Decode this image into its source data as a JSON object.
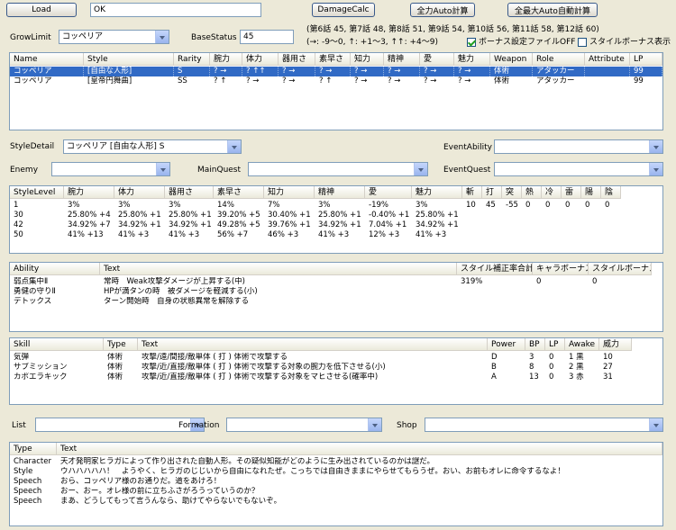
{
  "toolbar": {
    "load_label": "Load",
    "status_value": "OK",
    "damagecalc_label": "DamageCalc",
    "full_auto_label": "全力Auto計算",
    "max_auto_label": "全最大Auto自動計算"
  },
  "growlimit": {
    "label": "GrowLimit",
    "value": "コッペリア"
  },
  "basestatus": {
    "label": "BaseStatus",
    "value": "45"
  },
  "episodes_text": "(第6話 45, 第7話 48, 第8話 51, 第9話 54, 第10話 56, 第11話 58, 第12話 60)",
  "arrow_legend": "(→: -9〜0, ↑: +1〜3, ↑↑: +4〜9)",
  "bonus_file_label": "ボーナス設定ファイルOFF",
  "style_bonus_label": "スタイルボーナス表示",
  "styles_table": {
    "headers": [
      "Name",
      "Style",
      "Rarity",
      "腕力",
      "体力",
      "器用さ",
      "素早さ",
      "知力",
      "精神",
      "愛",
      "魅力",
      "Weapon",
      "Role",
      "Attribute",
      "LP"
    ],
    "rows": [
      [
        "コッペリア",
        "[自由な人形]",
        "S",
        "? →",
        "? ↑↑",
        "? →",
        "? →",
        "? →",
        "? →",
        "? →",
        "? →",
        "体術",
        "アタッカー",
        "",
        "99"
      ],
      [
        "コッペリア",
        "[皇帝円舞曲]",
        "SS",
        "? ↑",
        "? →",
        "? →",
        "? ↑",
        "? →",
        "? →",
        "? →",
        "? →",
        "体術",
        "アタッカー",
        "",
        "99"
      ]
    ]
  },
  "styledetail": {
    "label": "StyleDetail",
    "value": "コッペリア [自由な人形] S"
  },
  "eventability": {
    "label": "EventAbility",
    "value": ""
  },
  "enemy": {
    "label": "Enemy",
    "value": ""
  },
  "mainquest": {
    "label": "MainQuest",
    "value": ""
  },
  "eventquest": {
    "label": "EventQuest",
    "value": ""
  },
  "level_table": {
    "headers": [
      "StyleLevel",
      "腕力",
      "体力",
      "器用さ",
      "素早さ",
      "知力",
      "精神",
      "愛",
      "魅力",
      "斬",
      "打",
      "突",
      "熱",
      "冷",
      "雷",
      "陽",
      "陰"
    ],
    "rows": [
      [
        "1",
        "3%",
        "3%",
        "3%",
        "14%",
        "7%",
        "3%",
        "-19%",
        "3%",
        "10",
        "45",
        "-55",
        "0",
        "0",
        "0",
        "0",
        "0"
      ],
      [
        "30",
        "25.80% +4",
        "25.80% +1",
        "25.80% +1",
        "39.20% +5",
        "30.40% +1",
        "25.80% +1",
        "-0.40% +1",
        "25.80% +1",
        "",
        "",
        "",
        "",
        "",
        "",
        "",
        ""
      ],
      [
        "42",
        "34.92% +7",
        "34.92% +1",
        "34.92% +1",
        "49.28% +5",
        "39.76% +1",
        "34.92% +1",
        "7.04% +1",
        "34.92% +1",
        "",
        "",
        "",
        "",
        "",
        "",
        "",
        ""
      ],
      [
        "50",
        "41% +13",
        "41% +3",
        "41% +3",
        "56% +7",
        "46% +3",
        "41% +3",
        "12% +3",
        "41% +3",
        "",
        "",
        "",
        "",
        "",
        "",
        "",
        ""
      ]
    ]
  },
  "ability_table": {
    "headers": [
      "Ability",
      "Text",
      "スタイル補正率合計",
      "キャラボーナス",
      "スタイルボーナス"
    ],
    "rows": [
      [
        "弱点集中Ⅱ",
        "常時　Weak攻撃ダメージが上昇する(中)",
        "319%",
        "0",
        "0"
      ],
      [
        "勇健の守りⅡ",
        "HPが満タンの時　被ダメージを軽減する(小)",
        "",
        "",
        ""
      ],
      [
        "デトックス",
        "ターン開始時　自身の状態異常を解除する",
        "",
        "",
        ""
      ]
    ]
  },
  "skill_table": {
    "headers": [
      "Skill",
      "Type",
      "Text",
      "Power",
      "BP",
      "LP",
      "Awake",
      "威力"
    ],
    "rows": [
      [
        "気弾",
        "体術",
        "攻撃/遠/間接/敵単体 ( 打 ) 体術で攻撃する",
        "D",
        "3",
        "0",
        "1 黒",
        "10"
      ],
      [
        "サブミッション",
        "体術",
        "攻撃/近/直接/敵単体 ( 打 ) 体術で攻撃する対象の腕力を低下させる(小)",
        "B",
        "8",
        "0",
        "2 黒",
        "27"
      ],
      [
        "カポエラキック",
        "体術",
        "攻撃/近/直接/敵単体 ( 打 ) 体術で攻撃する対象をマヒさせる(確率中)",
        "A",
        "13",
        "0",
        "3 赤",
        "31"
      ]
    ]
  },
  "list": {
    "label": "List",
    "value": ""
  },
  "formation": {
    "label": "Formation",
    "value": ""
  },
  "shop": {
    "label": "Shop",
    "value": ""
  },
  "text_table": {
    "headers": [
      "Type",
      "Text"
    ],
    "rows": [
      [
        "Character",
        "天才発明家ヒラガによって作り出された自動人形。その疑似知能がどのように生み出されているのかは謎だ。"
      ],
      [
        "Style",
        "ウハハハハハ！　ようやく、ヒラガのじじいから自由になれたぜ。こっちでは自由きままにやらせてもらうぜ。おい、お前もオレに命令するなよ！"
      ],
      [
        "Speech",
        "おら、コッペリア様のお通りだ。道をあけろ！"
      ],
      [
        "Speech",
        "おー、おー。オレ様の前に立ちふさがろうっていうのか？"
      ],
      [
        "Speech",
        "まあ、どうしてもって言うんなら、助けてやらないでもないぞ。"
      ]
    ]
  }
}
